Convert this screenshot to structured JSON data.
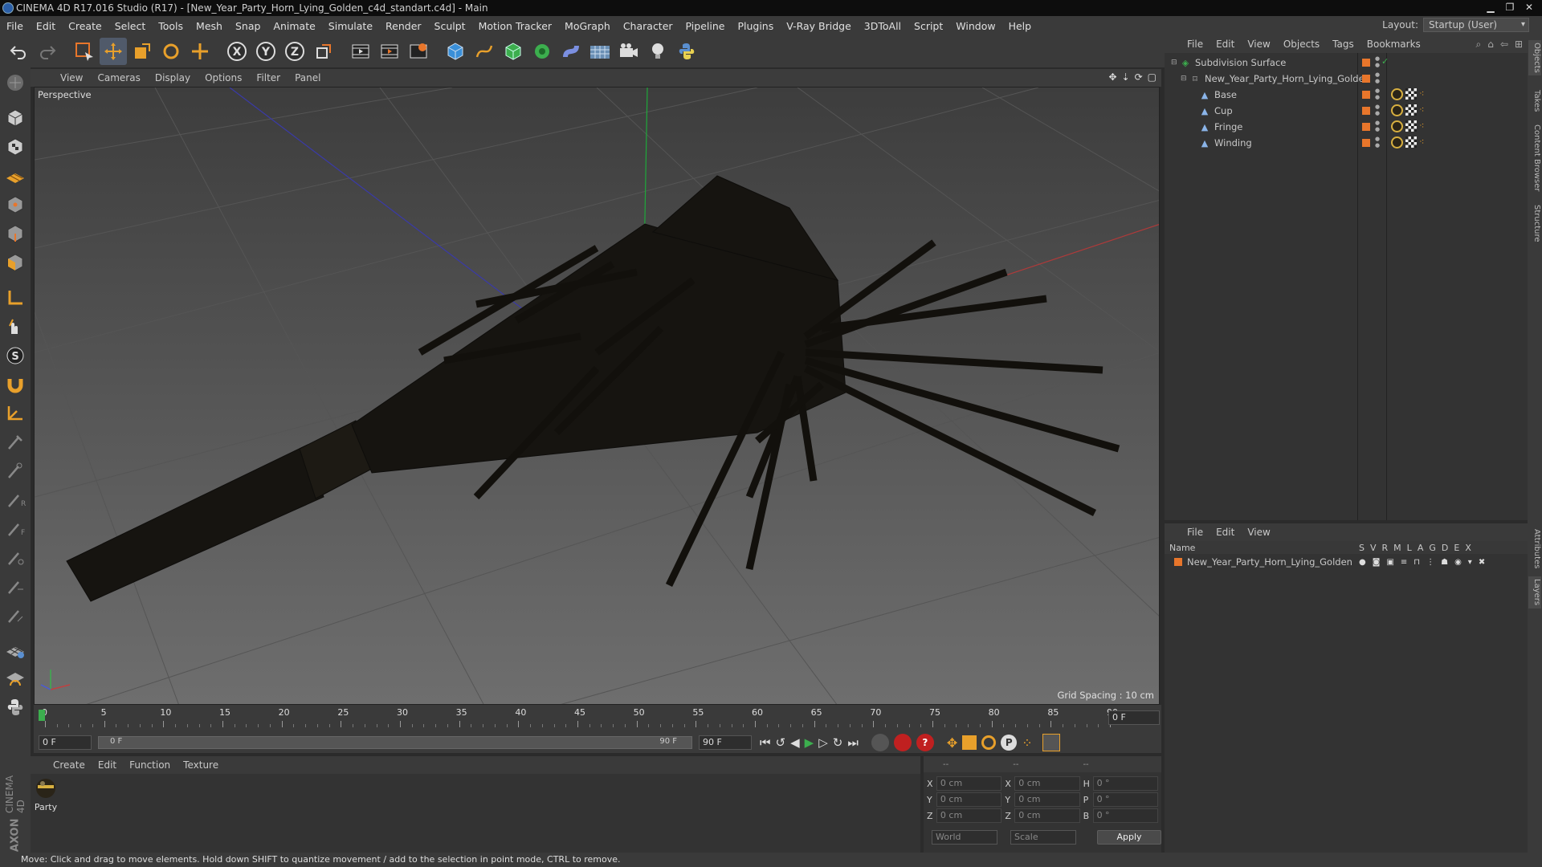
{
  "window": {
    "title": "CINEMA 4D R17.016 Studio (R17) - [New_Year_Party_Horn_Lying_Golden_c4d_standart.c4d] - Main"
  },
  "menu": [
    "File",
    "Edit",
    "Create",
    "Select",
    "Tools",
    "Mesh",
    "Snap",
    "Animate",
    "Simulate",
    "Render",
    "Sculpt",
    "Motion Tracker",
    "MoGraph",
    "Character",
    "Pipeline",
    "Plugins",
    "V-Ray Bridge",
    "3DToAll",
    "Script",
    "Window",
    "Help"
  ],
  "layout": {
    "label": "Layout:",
    "value": "Startup (User)"
  },
  "viewport": {
    "menu": [
      "View",
      "Cameras",
      "Display",
      "Options",
      "Filter",
      "Panel"
    ],
    "label": "Perspective",
    "grid_spacing": "Grid Spacing : 10 cm"
  },
  "timeline": {
    "ticks": [
      "0",
      "5",
      "10",
      "15",
      "20",
      "25",
      "30",
      "35",
      "40",
      "45",
      "50",
      "55",
      "60",
      "65",
      "70",
      "75",
      "80",
      "85",
      "90"
    ],
    "current": "0 F",
    "start": "0 F",
    "range_start": "0 F",
    "range_end": "90 F",
    "end": "90 F"
  },
  "material_panel": {
    "menu": [
      "Create",
      "Edit",
      "Function",
      "Texture"
    ],
    "materials": [
      {
        "name": "Party"
      }
    ]
  },
  "coords": {
    "headers": [
      "--",
      "--",
      "--"
    ],
    "rows": [
      {
        "a": "X",
        "av": "0 cm",
        "b": "X",
        "bv": "0 cm",
        "c": "H",
        "cv": "0 °"
      },
      {
        "a": "Y",
        "av": "0 cm",
        "b": "Y",
        "bv": "0 cm",
        "c": "P",
        "cv": "0 °"
      },
      {
        "a": "Z",
        "av": "0 cm",
        "b": "Z",
        "bv": "0 cm",
        "c": "B",
        "cv": "0 °"
      }
    ],
    "world": "World",
    "scale": "Scale",
    "apply": "Apply"
  },
  "object_manager": {
    "menu": [
      "File",
      "Edit",
      "View",
      "Objects",
      "Tags",
      "Bookmarks"
    ],
    "objects": [
      {
        "name": "Subdivision Surface",
        "indent": 0
      },
      {
        "name": "New_Year_Party_Horn_Lying_Golden",
        "indent": 1
      },
      {
        "name": "Base",
        "indent": 2
      },
      {
        "name": "Cup",
        "indent": 2
      },
      {
        "name": "Fringe",
        "indent": 2
      },
      {
        "name": "Winding",
        "indent": 2
      }
    ]
  },
  "layer_manager": {
    "menu": [
      "File",
      "Edit",
      "View"
    ],
    "header_name": "Name",
    "columns": [
      "S",
      "V",
      "R",
      "M",
      "L",
      "A",
      "G",
      "D",
      "E",
      "X"
    ],
    "layers": [
      {
        "name": "New_Year_Party_Horn_Lying_Golden"
      }
    ]
  },
  "right_tabs": [
    "Objects",
    "Takes",
    "Content Browser",
    "Structure",
    "Attributes",
    "Layers"
  ],
  "status": "Move: Click and drag to move elements. Hold down SHIFT to quantize movement / add to the selection in point mode, CTRL to remove.",
  "logo": {
    "line1": "MAXON",
    "line2": "CINEMA 4D"
  },
  "colors": {
    "accent_orange": "#e8762b",
    "selection_blue": "#3a7bd5"
  }
}
